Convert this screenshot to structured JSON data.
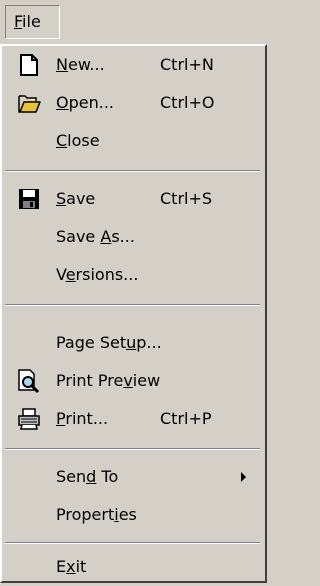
{
  "menubar": {
    "title_prefix": "",
    "title_mnemonic": "F",
    "title_rest": "ile"
  },
  "menu": {
    "items": [
      {
        "icon": "new-document-icon",
        "label_pre": "",
        "label_mnemonic": "N",
        "label_post": "ew...",
        "shortcut": "Ctrl+N"
      },
      {
        "icon": "open-folder-icon",
        "label_pre": "",
        "label_mnemonic": "O",
        "label_post": "pen...",
        "shortcut": "Ctrl+O"
      },
      {
        "icon": null,
        "label_pre": "",
        "label_mnemonic": "C",
        "label_post": "lose",
        "shortcut": ""
      },
      {
        "icon": "save-disk-icon",
        "label_pre": "",
        "label_mnemonic": "S",
        "label_post": "ave",
        "shortcut": "Ctrl+S"
      },
      {
        "icon": null,
        "label_pre": "Save ",
        "label_mnemonic": "A",
        "label_post": "s...",
        "shortcut": ""
      },
      {
        "icon": null,
        "label_pre": "V",
        "label_mnemonic": "e",
        "label_post": "rsions...",
        "shortcut": ""
      },
      {
        "icon": null,
        "label_pre": "Page Set",
        "label_mnemonic": "u",
        "label_post": "p...",
        "shortcut": ""
      },
      {
        "icon": "print-preview-icon",
        "label_pre": "Print Pre",
        "label_mnemonic": "v",
        "label_post": "iew",
        "shortcut": ""
      },
      {
        "icon": "printer-icon",
        "label_pre": "",
        "label_mnemonic": "P",
        "label_post": "rint...",
        "shortcut": "Ctrl+P"
      },
      {
        "icon": null,
        "label_pre": "Sen",
        "label_mnemonic": "d",
        "label_post": " To",
        "shortcut": "",
        "submenu": true
      },
      {
        "icon": null,
        "label_pre": "Propert",
        "label_mnemonic": "i",
        "label_post": "es",
        "shortcut": ""
      },
      {
        "icon": null,
        "label_pre": "E",
        "label_mnemonic": "x",
        "label_post": "it",
        "shortcut": ""
      }
    ]
  }
}
